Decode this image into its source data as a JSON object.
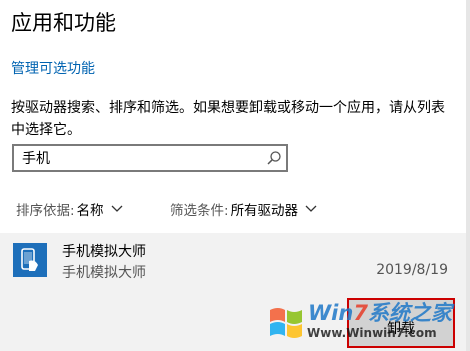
{
  "page": {
    "title": "应用和功能",
    "manage_link": "管理可选功能",
    "description": "按驱动器搜索、排序和筛选。如果想要卸载或移动一个应用，请从列表中选择它。"
  },
  "search": {
    "value": "手机",
    "icon": "search-icon"
  },
  "sort": {
    "label": "排序依据:",
    "value": "名称"
  },
  "filter": {
    "label": "筛选条件:",
    "value": "所有驱动器"
  },
  "app": {
    "name": "手机模拟大师",
    "publisher": "手机模拟大师",
    "date": "2019/8/19",
    "icon_color": "#1e6fba"
  },
  "actions": {
    "uninstall_label": "卸载"
  },
  "watermark": {
    "brand_a": "Win",
    "brand_b": "7",
    "brand_c": "系统之家",
    "url": "Www.Winwin7.com"
  },
  "colors": {
    "link": "#0063b1",
    "highlight_border": "#cc0000",
    "item_bg": "#f2f2f2"
  }
}
